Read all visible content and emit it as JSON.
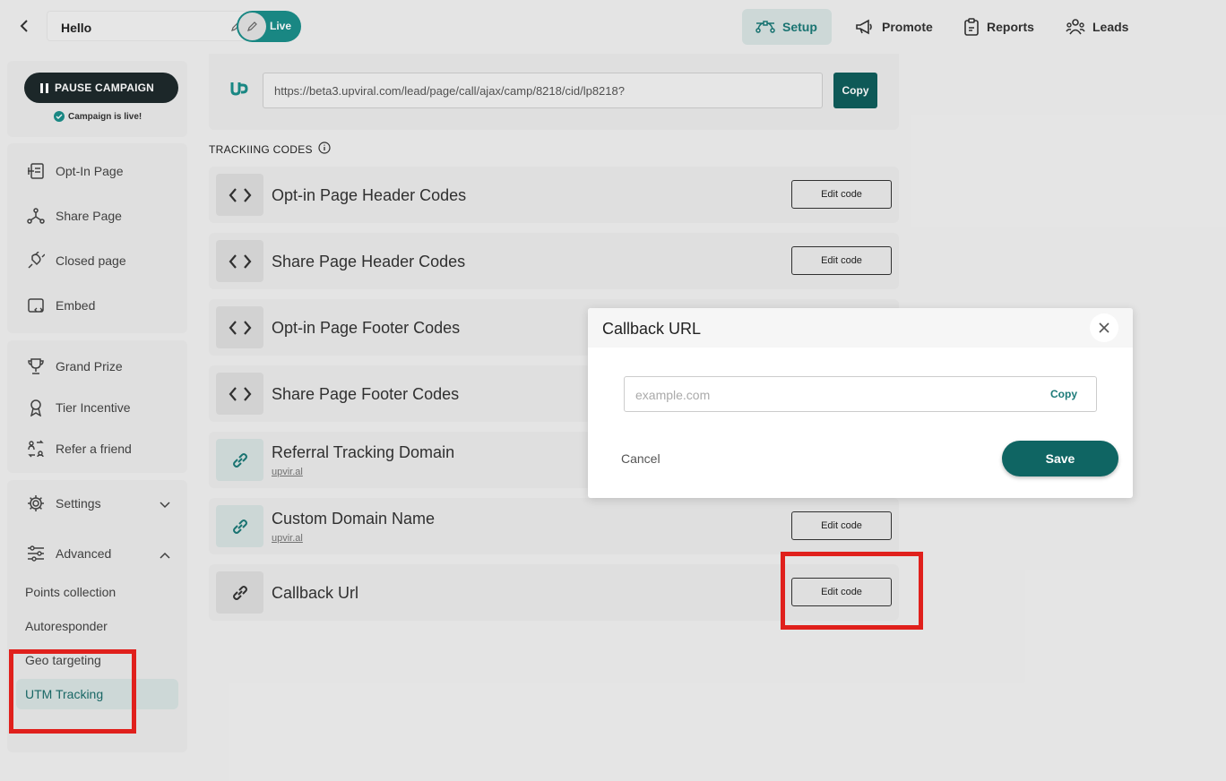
{
  "header": {
    "campaign_name": "Hello",
    "live_label": "Live",
    "nav": [
      {
        "label": "Setup",
        "icon": "setup-icon",
        "active": true
      },
      {
        "label": "Promote",
        "icon": "megaphone-icon"
      },
      {
        "label": "Reports",
        "icon": "clipboard-icon"
      },
      {
        "label": "Leads",
        "icon": "users-icon"
      }
    ]
  },
  "sidebar": {
    "pause_label": "PAUSE CAMPAIGN",
    "live_note": "Campaign is live!",
    "pages": [
      {
        "label": "Opt-In Page",
        "icon": "optin-page-icon"
      },
      {
        "label": "Share Page",
        "icon": "share-page-icon"
      },
      {
        "label": "Closed page",
        "icon": "plug-icon"
      },
      {
        "label": "Embed",
        "icon": "embed-icon"
      }
    ],
    "incentives": [
      {
        "label": "Grand Prize",
        "icon": "trophy-icon"
      },
      {
        "label": "Tier Incentive",
        "icon": "award-icon"
      },
      {
        "label": "Refer a friend",
        "icon": "refer-icon"
      }
    ],
    "settings_label": "Settings",
    "advanced_label": "Advanced",
    "advanced_items": [
      "Points collection",
      "Autoresponder",
      "Geo targeting",
      "UTM Tracking"
    ],
    "active_item": "UTM Tracking"
  },
  "main": {
    "url_value": "https://beta3.upviral.com/lead/page/call/ajax/camp/8218/cid/lp8218?",
    "copy_label": "Copy",
    "section_title": "TRACKIING CODES",
    "rows": [
      {
        "title": "Opt-in Page Header Codes",
        "icon": "code-icon",
        "button": "Edit code"
      },
      {
        "title": "Share Page Header Codes",
        "icon": "code-icon",
        "button": "Edit code"
      },
      {
        "title": "Opt-in Page Footer Codes",
        "icon": "code-icon"
      },
      {
        "title": "Share Page Footer Codes",
        "icon": "code-icon"
      },
      {
        "title": "Referral Tracking Domain",
        "sub": "upvir.al",
        "icon": "link-icon"
      },
      {
        "title": "Custom Domain Name",
        "sub": "upvir.al",
        "icon": "link-icon",
        "button": "Edit code"
      },
      {
        "title": "Callback Url",
        "icon": "link-icon",
        "button": "Edit code"
      }
    ]
  },
  "modal": {
    "title": "Callback URL",
    "placeholder": "example.com",
    "copy_label": "Copy",
    "cancel_label": "Cancel",
    "save_label": "Save"
  },
  "colors": {
    "accent": "#0f6563",
    "toggle": "#1b8f8b",
    "highlight": "#e0201c"
  }
}
